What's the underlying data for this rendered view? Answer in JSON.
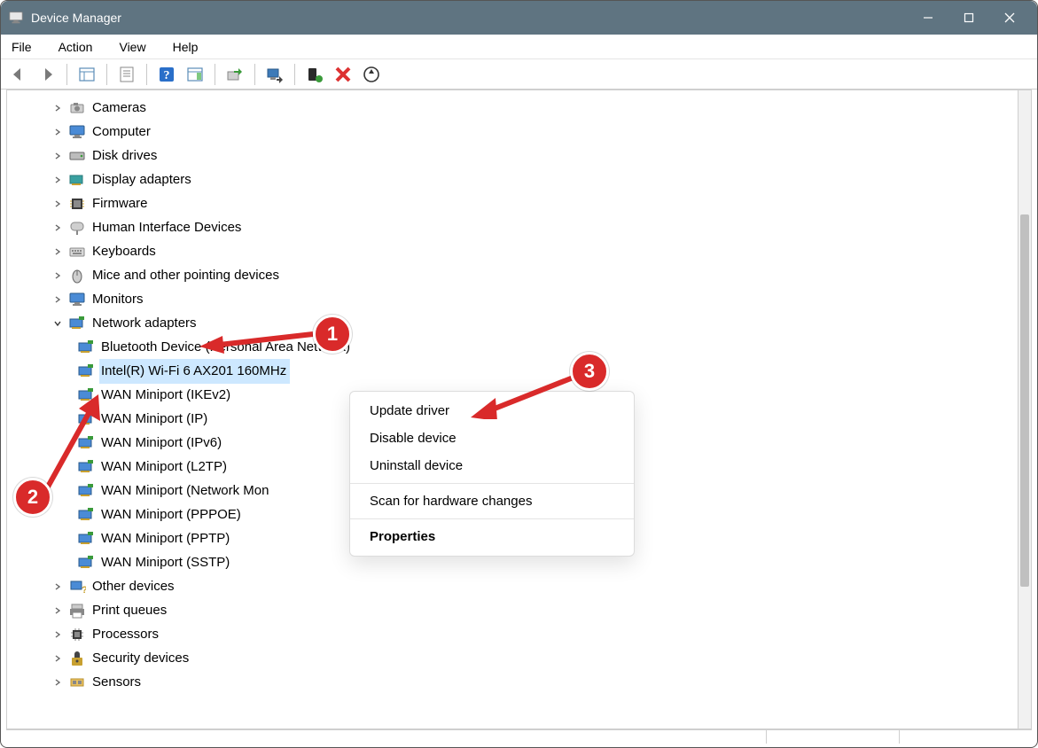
{
  "window": {
    "title": "Device Manager"
  },
  "menubar": {
    "items": [
      "File",
      "Action",
      "View",
      "Help"
    ]
  },
  "context_menu": {
    "items": [
      {
        "label": "Update driver",
        "bold": false
      },
      {
        "label": "Disable device",
        "bold": false
      },
      {
        "label": "Uninstall device",
        "bold": false
      },
      {
        "sep": true
      },
      {
        "label": "Scan for hardware changes",
        "bold": false
      },
      {
        "sep": true
      },
      {
        "label": "Properties",
        "bold": true
      }
    ]
  },
  "tree": {
    "top_visible_cutoff": true,
    "categories": [
      {
        "label": "Cameras",
        "icon": "camera",
        "expanded": false,
        "indent": 1
      },
      {
        "label": "Computer",
        "icon": "monitor",
        "expanded": false,
        "indent": 1
      },
      {
        "label": "Disk drives",
        "icon": "disk",
        "expanded": false,
        "indent": 1
      },
      {
        "label": "Display adapters",
        "icon": "display-adapter",
        "expanded": false,
        "indent": 1
      },
      {
        "label": "Firmware",
        "icon": "firmware",
        "expanded": false,
        "indent": 1
      },
      {
        "label": "Human Interface Devices",
        "icon": "hid",
        "expanded": false,
        "indent": 1
      },
      {
        "label": "Keyboards",
        "icon": "keyboard",
        "expanded": false,
        "indent": 1
      },
      {
        "label": "Mice and other pointing devices",
        "icon": "mouse",
        "expanded": false,
        "indent": 1
      },
      {
        "label": "Monitors",
        "icon": "monitor",
        "expanded": false,
        "indent": 1
      },
      {
        "label": "Network adapters",
        "icon": "nic",
        "expanded": true,
        "indent": 1,
        "children": [
          {
            "label": "Bluetooth Device (Personal Area Network)",
            "icon": "nic",
            "indent": 2
          },
          {
            "label": "Intel(R) Wi-Fi 6 AX201 160MHz",
            "icon": "nic",
            "indent": 2,
            "selected": true
          },
          {
            "label": "WAN Miniport (IKEv2)",
            "icon": "nic",
            "indent": 2
          },
          {
            "label": "WAN Miniport (IP)",
            "icon": "nic",
            "indent": 2
          },
          {
            "label": "WAN Miniport (IPv6)",
            "icon": "nic",
            "indent": 2
          },
          {
            "label": "WAN Miniport (L2TP)",
            "icon": "nic",
            "indent": 2
          },
          {
            "label": "WAN Miniport (Network Mon",
            "icon": "nic",
            "indent": 2
          },
          {
            "label": "WAN Miniport (PPPOE)",
            "icon": "nic",
            "indent": 2
          },
          {
            "label": "WAN Miniport (PPTP)",
            "icon": "nic",
            "indent": 2
          },
          {
            "label": "WAN Miniport (SSTP)",
            "icon": "nic",
            "indent": 2
          }
        ]
      },
      {
        "label": "Other devices",
        "icon": "other",
        "expanded": false,
        "indent": 1
      },
      {
        "label": "Print queues",
        "icon": "printer",
        "expanded": false,
        "indent": 1
      },
      {
        "label": "Processors",
        "icon": "cpu",
        "expanded": false,
        "indent": 1
      },
      {
        "label": "Security devices",
        "icon": "security",
        "expanded": false,
        "indent": 1
      },
      {
        "label": "Sensors",
        "icon": "sensor",
        "expanded": false,
        "indent": 1
      }
    ]
  },
  "annotations": {
    "badges": [
      "1",
      "2",
      "3"
    ]
  }
}
